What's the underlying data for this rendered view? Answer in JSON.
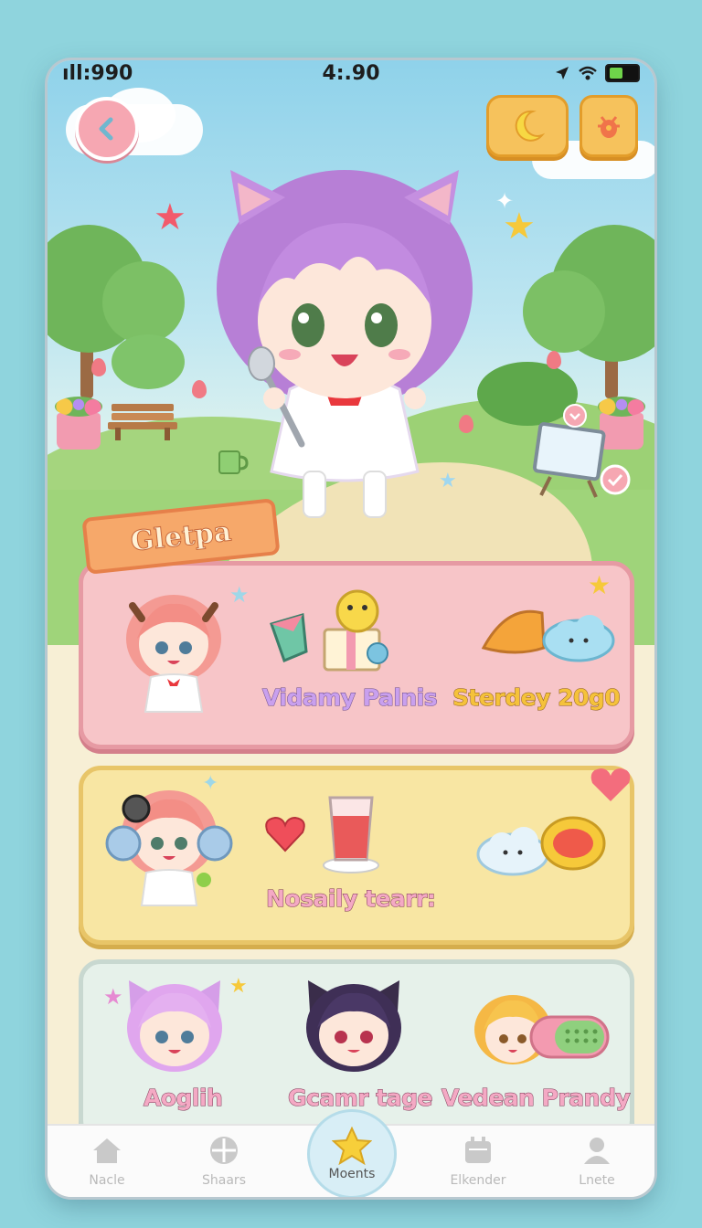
{
  "status_bar": {
    "signal": "ıll:990",
    "time": "4:.90"
  },
  "banner": {
    "title": "Gletpa"
  },
  "cards": [
    {
      "labels": [
        "Vidamy Palnis",
        "Sterdey 20g0"
      ]
    },
    {
      "labels": [
        "Nosaily tearr:"
      ]
    },
    {
      "labels": [
        "Aoglih",
        "Gcamr tage",
        "Vedean Prandy"
      ]
    }
  ],
  "tabs": [
    {
      "label": "Nacle",
      "icon": "home-icon"
    },
    {
      "label": "Shaars",
      "icon": "grid-icon"
    },
    {
      "label": "Moents",
      "icon": "star-icon",
      "active": true
    },
    {
      "label": "Elkender",
      "icon": "calendar-icon"
    },
    {
      "label": "Lnete",
      "icon": "profile-icon"
    }
  ],
  "colors": {
    "background": "#8fd4dd",
    "pink_card": "#f7c5c8",
    "yellow_card": "#f8e6a3",
    "mint_card": "#e6f1ea",
    "button": "#f6c25c"
  }
}
